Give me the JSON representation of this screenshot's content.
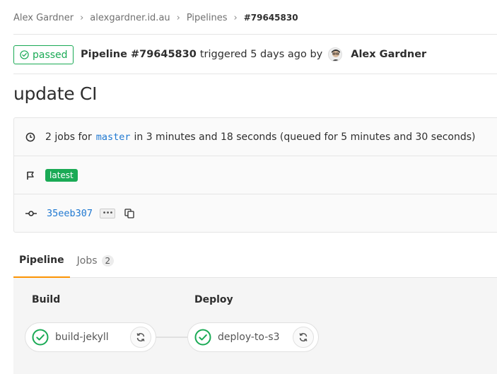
{
  "breadcrumb": {
    "items": [
      "Alex Gardner",
      "alexgardner.id.au",
      "Pipelines"
    ],
    "current": "#79645830",
    "separator": "›"
  },
  "header": {
    "status": "passed",
    "pipeline_label": "Pipeline #79645830",
    "triggered_text": "triggered 5 days ago by",
    "author": "Alex Gardner"
  },
  "title": "update CI",
  "info": {
    "jobs_prefix": "2 jobs for",
    "branch": "master",
    "jobs_suffix": "in 3 minutes and 18 seconds (queued for 5 minutes and 30 seconds)",
    "tag": "latest",
    "commit_sha": "35eeb307",
    "ellipsis": "•••"
  },
  "tabs": [
    {
      "label": "Pipeline",
      "active": true
    },
    {
      "label": "Jobs",
      "count": "2",
      "active": false
    }
  ],
  "stages": [
    {
      "name": "Build",
      "job": "build-jekyll"
    },
    {
      "name": "Deploy",
      "job": "deploy-to-s3"
    }
  ],
  "colors": {
    "success": "#1aaa55",
    "link": "#1f78d1",
    "tab_active": "#fc9403"
  },
  "icons": {
    "status": "check-circle-icon",
    "clock": "clock-icon",
    "flag": "flag-icon",
    "commit": "commit-icon",
    "copy": "copy-icon",
    "retry": "retry-icon"
  }
}
